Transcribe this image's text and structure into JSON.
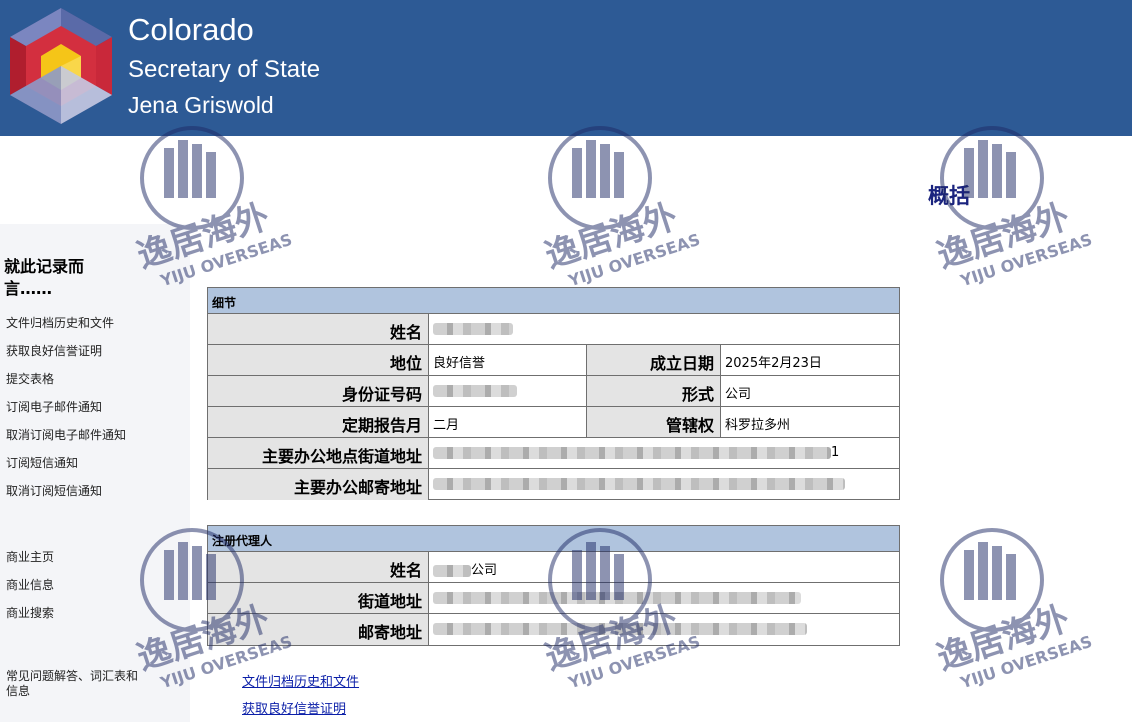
{
  "header": {
    "title": "Colorado",
    "subtitle": "Secretary of State",
    "official": "Jena Griswold"
  },
  "sidebar": {
    "heading": "就此记录而言……",
    "record_links": [
      "文件归档历史和文件",
      "获取良好信誉证明",
      "提交表格",
      "订阅电子邮件通知",
      "取消订阅电子邮件通知",
      "订阅短信通知",
      "取消订阅短信通知"
    ],
    "business_links": [
      "商业主页",
      "商业信息",
      "商业搜索"
    ],
    "faq_link": "常见问题解答、词汇表和信息"
  },
  "summary_title": "概括",
  "details": {
    "section_title": "细节",
    "name_label": "姓名",
    "status_label": "地位",
    "status_value": "良好信誉",
    "formation_date_label": "成立日期",
    "formation_date_value": "2025年2月23日",
    "id_label": "身份证号码",
    "form_label": "形式",
    "form_value": "公司",
    "periodic_month_label": "定期报告月",
    "periodic_month_value": "二月",
    "jurisdiction_label": "管辖权",
    "jurisdiction_value": "科罗拉多州",
    "principal_street_label": "主要办公地点街道地址",
    "principal_street_suffix": "1",
    "principal_mailing_label": "主要办公邮寄地址"
  },
  "agent": {
    "section_title": "注册代理人",
    "name_label": "姓名",
    "name_value_suffix": "公司",
    "street_label": "街道地址",
    "mailing_label": "邮寄地址"
  },
  "bottom_links": [
    "文件归档历史和文件",
    "获取良好信誉证明"
  ],
  "watermark": {
    "cn_text": "逸居海外",
    "en_text": "YIJU OVERSEAS"
  },
  "colors": {
    "header_bg": "#2d5a95",
    "section_header_bg": "#b0c4de",
    "label_bg": "#e4e4e4",
    "summary_title": "#1a237e",
    "link": "#0b1fa8"
  }
}
